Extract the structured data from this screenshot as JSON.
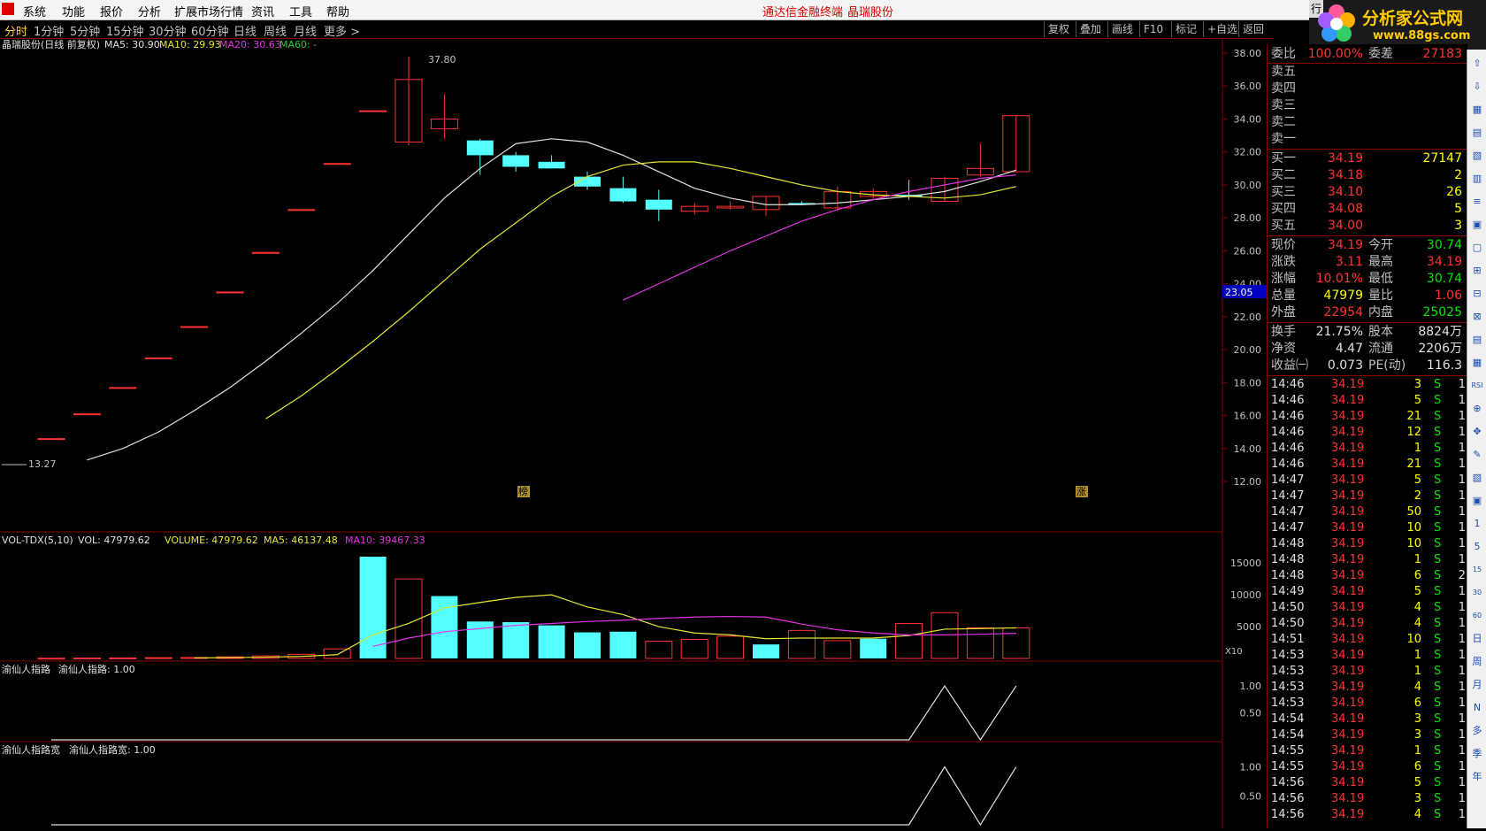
{
  "menu": {
    "items": [
      "系统",
      "功能",
      "报价",
      "分析",
      "扩展市场行情",
      "资讯",
      "工具",
      "帮助"
    ],
    "app_title": "通达信金融终端",
    "stock_title": "晶瑞股份",
    "corner_label": "行"
  },
  "brand": {
    "title": "分析家公式网",
    "url": "www.88gs.com"
  },
  "tabs": [
    "分时",
    "1分钟",
    "5分钟",
    "15分钟",
    "30分钟",
    "60分钟",
    "日线",
    "周线",
    "月线",
    "更多 >"
  ],
  "tools": [
    "复权",
    "叠加",
    "画线",
    "F10",
    "标记",
    "+自选",
    "返回"
  ],
  "main_chart": {
    "header_name": "晶瑞股份(日线 前复权)",
    "ma5_label": "MA5: 30.90",
    "ma10_label": "MA10: 29.93",
    "ma20_label": "MA20: 30.63",
    "ma60_label": "MA60: -",
    "high_mark": "37.80",
    "low_mark": "13.27",
    "price_tag": "23.05",
    "marker_bang": "榜",
    "marker_zhang": "涨",
    "y_ticks": [
      "38.00",
      "36.00",
      "34.00",
      "32.00",
      "30.00",
      "28.00",
      "26.00",
      "24.00",
      "22.00",
      "20.00",
      "18.00",
      "16.00",
      "14.00",
      "12.00"
    ]
  },
  "chart_data": [
    {
      "type": "candlestick",
      "y_range": [
        12,
        38
      ],
      "series": [
        {
          "name": "K",
          "ohlc": [
            [
              14.6,
              14.6,
              14.6,
              14.6
            ],
            [
              16.1,
              16.1,
              16.1,
              16.1
            ],
            [
              17.7,
              17.7,
              17.7,
              17.7
            ],
            [
              19.5,
              19.5,
              19.5,
              19.5
            ],
            [
              21.4,
              21.4,
              21.4,
              21.4
            ],
            [
              23.5,
              23.5,
              23.5,
              23.5
            ],
            [
              25.9,
              25.9,
              25.9,
              25.9
            ],
            [
              28.5,
              28.5,
              28.5,
              28.5
            ],
            [
              31.3,
              31.3,
              31.3,
              31.3
            ],
            [
              34.5,
              34.5,
              34.5,
              34.5
            ],
            [
              32.6,
              37.8,
              32.4,
              36.4
            ],
            [
              33.4,
              35.5,
              32.8,
              34.0
            ],
            [
              32.7,
              32.8,
              30.6,
              31.8
            ],
            [
              31.8,
              32.0,
              30.8,
              31.1
            ],
            [
              31.4,
              31.8,
              31.0,
              31.0
            ],
            [
              30.5,
              30.8,
              29.7,
              29.9
            ],
            [
              29.8,
              30.5,
              28.9,
              29.0
            ],
            [
              29.1,
              29.7,
              27.8,
              28.5
            ],
            [
              28.4,
              28.9,
              28.2,
              28.7
            ],
            [
              28.6,
              29.0,
              28.5,
              28.7
            ],
            [
              28.5,
              29.3,
              28.1,
              29.3
            ],
            [
              28.9,
              29.0,
              28.8,
              28.8
            ],
            [
              28.6,
              29.9,
              28.4,
              29.6
            ],
            [
              29.3,
              29.8,
              29.1,
              29.6
            ],
            [
              29.4,
              30.3,
              29.1,
              29.3
            ],
            [
              29.0,
              30.5,
              29.0,
              30.4
            ],
            [
              30.6,
              32.5,
              30.5,
              31.0
            ],
            [
              30.8,
              34.2,
              30.8,
              34.2
            ]
          ]
        },
        {
          "name": "MA5",
          "values": [
            null,
            13.3,
            14.0,
            15.0,
            16.3,
            17.7,
            19.3,
            21.0,
            22.8,
            24.8,
            27.0,
            29.2,
            31.0,
            32.5,
            32.8,
            32.6,
            31.8,
            30.8,
            29.8,
            29.2,
            28.8,
            28.8,
            28.9,
            29.1,
            29.3,
            29.6,
            30.2,
            30.9
          ]
        },
        {
          "name": "MA10",
          "values": [
            null,
            null,
            null,
            null,
            null,
            null,
            15.8,
            17.2,
            18.8,
            20.5,
            22.3,
            24.2,
            26.1,
            27.7,
            29.3,
            30.5,
            31.2,
            31.4,
            31.4,
            31.0,
            30.5,
            30.0,
            29.6,
            29.4,
            29.3,
            29.2,
            29.4,
            29.9
          ]
        },
        {
          "name": "MA20",
          "values": [
            null,
            null,
            null,
            null,
            null,
            null,
            null,
            null,
            null,
            null,
            null,
            null,
            null,
            null,
            null,
            null,
            23.0,
            24.0,
            25.0,
            26.0,
            26.9,
            27.8,
            28.5,
            29.1,
            29.6,
            30.0,
            30.4,
            30.6
          ]
        }
      ]
    },
    {
      "type": "bar",
      "title": "VOL-TDX(5,10)",
      "label_vol": "VOL: 47979.62",
      "label_volume": "VOLUME: 47979.62",
      "label_ma5": "MA5: 46137.48",
      "label_ma10": "MA10: 39467.33",
      "scale_label": "X10",
      "y_ticks": [
        "15000",
        "10000",
        "5000"
      ],
      "y_range": [
        0,
        16000
      ],
      "values": [
        40,
        60,
        80,
        120,
        150,
        250,
        400,
        650,
        1500,
        16000,
        12500,
        9800,
        5800,
        5700,
        5200,
        4100,
        4200,
        2700,
        3000,
        3500,
        2200,
        4400,
        2800,
        3100,
        5500,
        7200,
        4800,
        4800
      ],
      "up": [
        true,
        true,
        true,
        true,
        true,
        true,
        true,
        true,
        true,
        false,
        true,
        false,
        false,
        false,
        false,
        false,
        false,
        true,
        true,
        true,
        false,
        true,
        true,
        false,
        true,
        true,
        true,
        true
      ],
      "ma5": [
        null,
        null,
        null,
        null,
        80,
        130,
        200,
        310,
        590,
        3700,
        5500,
        7950,
        8800,
        9600,
        10000,
        8100,
        6900,
        5000,
        4000,
        3700,
        3100,
        3200,
        3200,
        3200,
        3600,
        4600,
        4700,
        4800
      ],
      "ma10": [
        null,
        null,
        null,
        null,
        null,
        null,
        null,
        null,
        null,
        1900,
        3200,
        4200,
        4700,
        5200,
        5500,
        5800,
        6000,
        6300,
        6500,
        6600,
        6500,
        5400,
        4500,
        4000,
        3700,
        3700,
        3800,
        3950
      ]
    },
    {
      "type": "line",
      "title": "渝仙人指路",
      "label": "渝仙人指路: 1.00",
      "y_ticks": [
        "1.00",
        "0.50"
      ],
      "y_range": [
        0,
        1.1
      ],
      "values": [
        0,
        0,
        0,
        0,
        0,
        0,
        0,
        0,
        0,
        0,
        0,
        0,
        0,
        0,
        0,
        0,
        0,
        0,
        0,
        0,
        0,
        0,
        0,
        0,
        0,
        1,
        0,
        1
      ]
    },
    {
      "type": "line",
      "title": "渝仙人指路宽",
      "label": "渝仙人指路宽: 1.00",
      "y_ticks": [
        "1.00",
        "0.50"
      ],
      "y_range": [
        0,
        1.1
      ],
      "values": [
        0,
        0,
        0,
        0,
        0,
        0,
        0,
        0,
        0,
        0,
        0,
        0,
        0,
        0,
        0,
        0,
        0,
        0,
        0,
        0,
        0,
        0,
        0,
        0,
        0,
        1,
        0,
        1
      ]
    }
  ],
  "quote": {
    "weibi": {
      "label": "委比",
      "value": "100.00%",
      "label2": "委差",
      "value2": "27183"
    },
    "sell": [
      {
        "label": "卖五"
      },
      {
        "label": "卖四"
      },
      {
        "label": "卖三"
      },
      {
        "label": "卖二"
      },
      {
        "label": "卖一"
      }
    ],
    "buy": [
      {
        "label": "买一",
        "price": "34.19",
        "vol": "27147"
      },
      {
        "label": "买二",
        "price": "34.18",
        "vol": "2"
      },
      {
        "label": "买三",
        "price": "34.10",
        "vol": "26"
      },
      {
        "label": "买四",
        "price": "34.08",
        "vol": "5"
      },
      {
        "label": "买五",
        "price": "34.00",
        "vol": "3"
      }
    ],
    "stats": [
      {
        "l1": "现价",
        "v1": "34.19",
        "c1": "up",
        "l2": "今开",
        "v2": "30.74",
        "c2": "dn"
      },
      {
        "l1": "涨跌",
        "v1": "3.11",
        "c1": "up",
        "l2": "最高",
        "v2": "34.19",
        "c2": "up"
      },
      {
        "l1": "涨幅",
        "v1": "10.01%",
        "c1": "up",
        "l2": "最低",
        "v2": "30.74",
        "c2": "dn"
      },
      {
        "l1": "总量",
        "v1": "47979",
        "c1": "ye",
        "l2": "量比",
        "v2": "1.06",
        "c2": "up"
      },
      {
        "l1": "外盘",
        "v1": "22954",
        "c1": "up",
        "l2": "内盘",
        "v2": "25025",
        "c2": "dn"
      }
    ],
    "stats2": [
      {
        "l1": "换手",
        "v1": "21.75%",
        "l2": "股本",
        "v2": "8824万"
      },
      {
        "l1": "净资",
        "v1": "4.47",
        "l2": "流通",
        "v2": "2206万"
      },
      {
        "l1": "收益㈠",
        "v1": "0.073",
        "l2": "PE(动)",
        "v2": "116.3"
      }
    ],
    "ticks": [
      {
        "t": "14:46",
        "p": "34.19",
        "v": "3",
        "s": "S",
        "n": "1"
      },
      {
        "t": "14:46",
        "p": "34.19",
        "v": "5",
        "s": "S",
        "n": "1"
      },
      {
        "t": "14:46",
        "p": "34.19",
        "v": "21",
        "s": "S",
        "n": "1"
      },
      {
        "t": "14:46",
        "p": "34.19",
        "v": "12",
        "s": "S",
        "n": "1"
      },
      {
        "t": "14:46",
        "p": "34.19",
        "v": "1",
        "s": "S",
        "n": "1"
      },
      {
        "t": "14:46",
        "p": "34.19",
        "v": "21",
        "s": "S",
        "n": "1"
      },
      {
        "t": "14:47",
        "p": "34.19",
        "v": "5",
        "s": "S",
        "n": "1"
      },
      {
        "t": "14:47",
        "p": "34.19",
        "v": "2",
        "s": "S",
        "n": "1"
      },
      {
        "t": "14:47",
        "p": "34.19",
        "v": "50",
        "s": "S",
        "n": "1"
      },
      {
        "t": "14:47",
        "p": "34.19",
        "v": "10",
        "s": "S",
        "n": "1"
      },
      {
        "t": "14:48",
        "p": "34.19",
        "v": "10",
        "s": "S",
        "n": "1"
      },
      {
        "t": "14:48",
        "p": "34.19",
        "v": "1",
        "s": "S",
        "n": "1"
      },
      {
        "t": "14:48",
        "p": "34.19",
        "v": "6",
        "s": "S",
        "n": "2"
      },
      {
        "t": "14:49",
        "p": "34.19",
        "v": "5",
        "s": "S",
        "n": "1"
      },
      {
        "t": "14:50",
        "p": "34.19",
        "v": "4",
        "s": "S",
        "n": "1"
      },
      {
        "t": "14:50",
        "p": "34.19",
        "v": "4",
        "s": "S",
        "n": "1"
      },
      {
        "t": "14:51",
        "p": "34.19",
        "v": "10",
        "s": "S",
        "n": "1"
      },
      {
        "t": "14:53",
        "p": "34.19",
        "v": "1",
        "s": "S",
        "n": "1"
      },
      {
        "t": "14:53",
        "p": "34.19",
        "v": "1",
        "s": "S",
        "n": "1"
      },
      {
        "t": "14:53",
        "p": "34.19",
        "v": "4",
        "s": "S",
        "n": "1"
      },
      {
        "t": "14:53",
        "p": "34.19",
        "v": "6",
        "s": "S",
        "n": "1"
      },
      {
        "t": "14:54",
        "p": "34.19",
        "v": "3",
        "s": "S",
        "n": "1"
      },
      {
        "t": "14:54",
        "p": "34.19",
        "v": "3",
        "s": "S",
        "n": "1"
      },
      {
        "t": "14:55",
        "p": "34.19",
        "v": "1",
        "s": "S",
        "n": "1"
      },
      {
        "t": "14:55",
        "p": "34.19",
        "v": "6",
        "s": "S",
        "n": "1"
      },
      {
        "t": "14:56",
        "p": "34.19",
        "v": "5",
        "s": "S",
        "n": "1"
      },
      {
        "t": "14:56",
        "p": "34.19",
        "v": "3",
        "s": "S",
        "n": "1"
      },
      {
        "t": "14:56",
        "p": "34.19",
        "v": "4",
        "s": "S",
        "n": "1"
      }
    ]
  },
  "iconstrip": [
    "⇧",
    "⇩",
    "▦",
    "▤",
    "▧",
    "▥",
    "≡",
    "▣",
    "▢",
    "⊞",
    "⊟",
    "⊠",
    "▤",
    "▦",
    "RSI",
    "⊕",
    "✥",
    "✎",
    "▧",
    "▣",
    "1",
    "5",
    "15",
    "30",
    "60",
    "日",
    "周",
    "月",
    "N",
    "多",
    "季",
    "年"
  ],
  "colors": {
    "up": "#ff3232",
    "down": "#54ffff",
    "ma5": "#e0e0e0",
    "ma10": "#e6e632",
    "ma20": "#e632e6",
    "grid": "#800000",
    "tag_bg": "#0000c0"
  }
}
